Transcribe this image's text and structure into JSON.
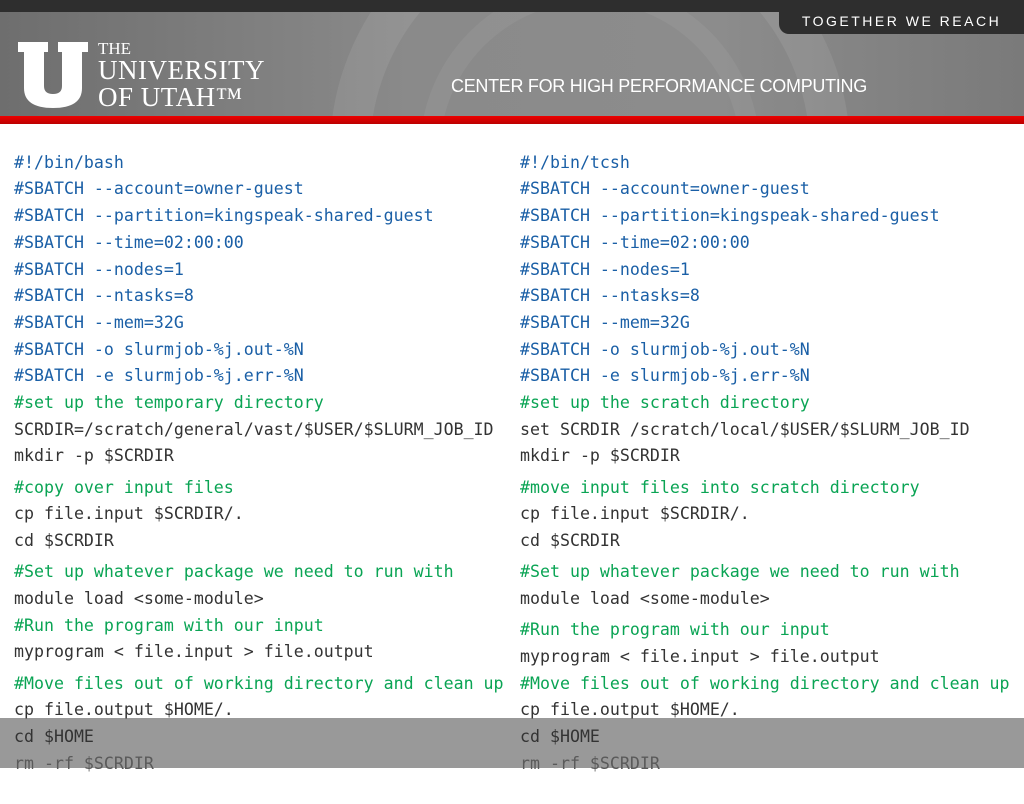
{
  "header": {
    "tagline": "TOGETHER WE REACH",
    "logo": {
      "line1": "THE",
      "line2": "UNIVERSITY",
      "line3": "OF UTAH™"
    },
    "center_title": "CENTER FOR HIGH PERFORMANCE COMPUTING"
  },
  "colors": {
    "directive": "#1a5fa6",
    "comment": "#0aa454",
    "code": "#333333",
    "accent_red": "#cc0000"
  },
  "left": [
    "#!/bin/bash",
    "#SBATCH --account=owner-guest",
    "#SBATCH --partition=kingspeak-shared-guest",
    "#SBATCH --time=02:00:00",
    "#SBATCH --nodes=1",
    "#SBATCH --ntasks=8",
    "#SBATCH --mem=32G",
    "#SBATCH -o slurmjob-%j.out-%N",
    "#SBATCH -e slurmjob-%j.err-%N",
    "#set up the temporary directory",
    "SCRDIR=/scratch/general/vast/$USER/$SLURM_JOB_ID",
    "mkdir -p $SCRDIR",
    "#copy over input files",
    "cp file.input $SCRDIR/.",
    "cd $SCRDIR",
    "#Set up whatever package we need to run with",
    "module load <some-module>",
    "#Run the program with our input",
    "myprogram < file.input > file.output",
    "#Move files out of working directory and clean up",
    "cp file.output $HOME/.",
    "cd $HOME",
    "rm -rf $SCRDIR"
  ],
  "right": [
    "#!/bin/tcsh",
    "#SBATCH --account=owner-guest",
    "#SBATCH --partition=kingspeak-shared-guest",
    "#SBATCH --time=02:00:00",
    "#SBATCH --nodes=1",
    "#SBATCH --ntasks=8",
    "#SBATCH --mem=32G",
    "#SBATCH -o slurmjob-%j.out-%N",
    "#SBATCH -e slurmjob-%j.err-%N",
    "#set up the scratch directory",
    "set SCRDIR /scratch/local/$USER/$SLURM_JOB_ID",
    "mkdir -p $SCRDIR",
    "#move input files into scratch directory",
    "cp file.input $SCRDIR/.",
    "cd $SCRDIR",
    "#Set up whatever package we need to run with",
    "module load <some-module>",
    "#Run the program with our input",
    "myprogram < file.input > file.output",
    "#Move files out of working directory and clean up",
    "cp file.output $HOME/.",
    "cd $HOME",
    "rm -rf $SCRDIR"
  ]
}
